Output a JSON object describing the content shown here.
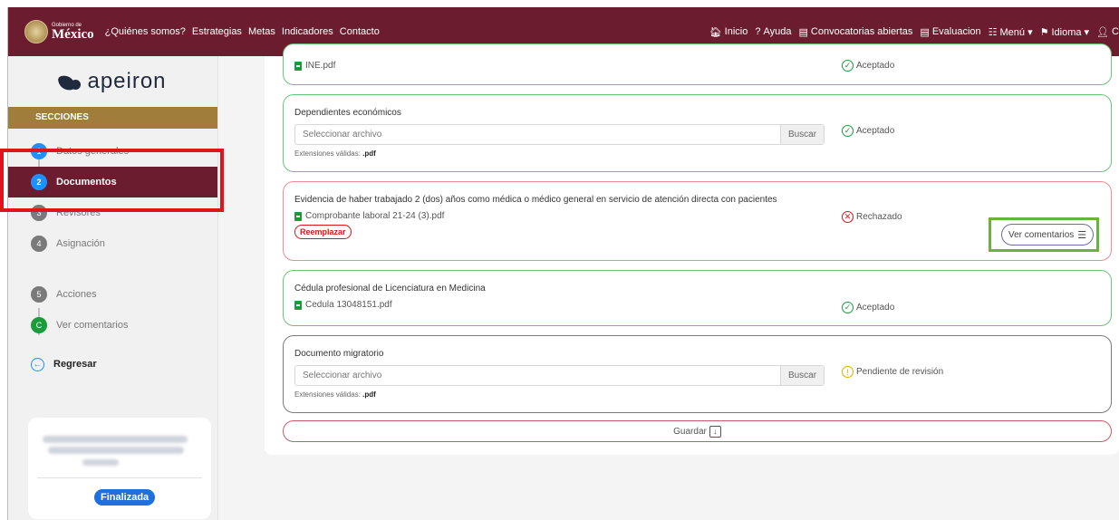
{
  "header": {
    "gov_small": "Gobierno de",
    "gov_big": "México",
    "nav_left": [
      "¿Quiénes somos?",
      "Estrategias",
      "Metas",
      "Indicadores",
      "Contacto"
    ],
    "nav_right": [
      {
        "icon": "home-icon",
        "glyph": "🏠︎",
        "label": "Inicio"
      },
      {
        "icon": "question-icon",
        "glyph": "?",
        "label": "Ayuda"
      },
      {
        "icon": "document-icon",
        "glyph": "▤",
        "label": "Convocatorias abiertas"
      },
      {
        "icon": "document-icon",
        "glyph": "▤",
        "label": "Evaluacion"
      },
      {
        "icon": "menu-icon",
        "glyph": "☷",
        "label": "Menú ▾"
      },
      {
        "icon": "flag-icon",
        "glyph": "⚑",
        "label": "Idioma ▾"
      },
      {
        "icon": "user-icon",
        "glyph": "👤︎",
        "label": "C"
      }
    ]
  },
  "sidebar": {
    "brand": "apeiron",
    "sections_title": "SECCIONES",
    "steps": [
      {
        "num": "1",
        "label": "Datos generales",
        "color": "blue"
      },
      {
        "num": "2",
        "label": "Documentos",
        "color": "blue",
        "active": true
      },
      {
        "num": "3",
        "label": "Revisores",
        "color": "grey"
      },
      {
        "num": "4",
        "label": "Asignación",
        "color": "grey"
      },
      {
        "num": "5",
        "label": "Acciones",
        "color": "grey"
      },
      {
        "num": "C",
        "label": "Ver comentarios",
        "color": "green"
      }
    ],
    "back_label": "Regresar",
    "user_status": "Finalizada"
  },
  "documents": [
    {
      "file": "INE.pdf",
      "status": "Aceptado"
    },
    {
      "title": "Dependientes económicos",
      "placeholder": "Seleccionar archivo",
      "browse": "Buscar",
      "ext_label": "Extensiones válidas:",
      "ext_value": ".pdf",
      "status": "Aceptado"
    },
    {
      "title": "Evidencia de haber trabajado 2 (dos) años como médica o médico general en servicio de atención directa con pacientes",
      "file": "Comprobante laboral 21-24 (3).pdf",
      "replace": "Reemplazar",
      "status": "Rechazado",
      "comments": "Ver comentarios"
    },
    {
      "title": "Cédula profesional de Licenciatura en Medicina",
      "file": "Cedula 13048151.pdf",
      "status": "Aceptado"
    },
    {
      "title": "Documento migratorio",
      "placeholder": "Seleccionar archivo",
      "browse": "Buscar",
      "ext_label": "Extensiones válidas:",
      "ext_value": ".pdf",
      "status": "Pendiente de revisión"
    }
  ],
  "save_label": "Guardar",
  "colors": {
    "brand": "#6b1c2e",
    "gold": "#a17d3c",
    "accepted": "#1a9c3b",
    "rejected": "#e0141b",
    "pending": "#e6a700",
    "step_blue": "#1e90ff"
  }
}
